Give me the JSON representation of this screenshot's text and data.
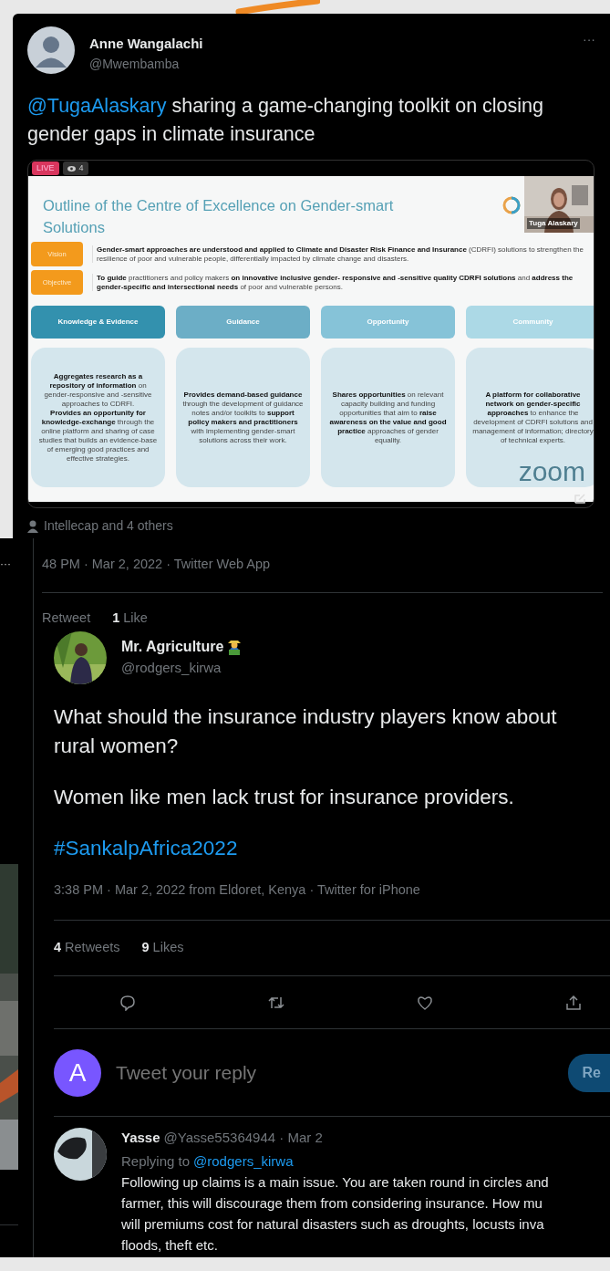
{
  "tweet": {
    "author": "Anne Wangalachi",
    "handle": "@Mwembamba",
    "more": "···",
    "mention": "@TugaAlaskary",
    "body": "sharing a game-changing toolkit on closing gender gaps in climate insurance",
    "video": {
      "live": "LIVE",
      "viewers": "4",
      "speaker": "Tuga Alaskary",
      "watermark": "zoom",
      "slide": {
        "title": "Outline of the Centre of Excellence on Gender-smart Solutions",
        "rows": [
          {
            "label": "Vision",
            "text": "**Gender-smart approaches are  understood and applied to Climate and Disaster Risk Finance and Insurance** (CDRFI) solutions to strengthen the resilience of poor and vulnerable people, differentially impacted by climate change and disasters."
          },
          {
            "label": "Objective",
            "text": "**To guide** practitioners and policy makers **on innovative inclusive gender- responsive and -sensitive quality CDRFI solutions** and **address the gender-specific and intersectional needs** of poor and vulnerable persons."
          }
        ],
        "columns": [
          {
            "heading": "Knowledge & Evidence",
            "color": "#3391ae",
            "text": "**Aggregates research as a repository of information** on gender-responsive and -sensitive approaches to CDRFI.\n**Provides an opportunity for knowledge-exchange** through the online platform and sharing of case studies that builds an evidence-base of emerging good practices and effective strategies."
          },
          {
            "heading": "Guidance",
            "color": "#6caec6",
            "text": "**Provides demand-based guidance** through the development of guidance notes and/or toolkits to **support policy makers and practitioners** with implementing gender-smart solutions across their work."
          },
          {
            "heading": "Opportunity",
            "color": "#86c3d8",
            "text": "**Shares opportunities** on relevant capacity building and funding opportunities that aim to **raise awareness on the value and good practice** approaches of gender equality."
          },
          {
            "heading": "Community",
            "color": "#acd9e6",
            "text": "**A platform for collaborative network on gender-specific approaches** to enhance the development of CDRFI solutions and management of information; directory of technical experts."
          }
        ]
      }
    },
    "tagged": "Intellecap and 4 others"
  },
  "thread": {
    "more": "···",
    "timestamp": "48 PM · Mar 2, 2022 · Twitter Web App",
    "stats": [
      {
        "label": "Retweet"
      },
      {
        "count": "1",
        "label": "Like"
      }
    ]
  },
  "reply_tweet": {
    "author": "Mr. Agriculture",
    "handle": "@rodgers_kirwa",
    "paragraphs": [
      "What should the insurance industry players know about rural women?",
      "Women like men lack trust for insurance providers."
    ],
    "hashtag": "#SankalpAfrica2022",
    "timestamp": "3:38 PM · Mar 2, 2022 from Eldoret, Kenya · Twitter for iPhone",
    "stats": [
      {
        "count": "4",
        "label": "Retweets"
      },
      {
        "count": "9",
        "label": "Likes"
      }
    ],
    "actions": [
      {
        "kind": "reply"
      },
      {
        "kind": "retweet"
      },
      {
        "kind": "like"
      },
      {
        "kind": "share"
      }
    ]
  },
  "composer": {
    "avatar_letter": "A",
    "placeholder": "Tweet your reply",
    "button": "Re"
  },
  "reply": {
    "author": "Yasse",
    "meta": "@Yasse55364944 · Mar 2",
    "replying_prefix": "Replying to",
    "replying_to": "@rodgers_kirwa",
    "lines": [
      "Following up claims is a main issue. You are taken round in circles and",
      "farmer, this will discourage them from considering insurance. How mu",
      "will premiums cost for natural disasters such as droughts, locusts inva",
      "floods, theft etc."
    ]
  }
}
